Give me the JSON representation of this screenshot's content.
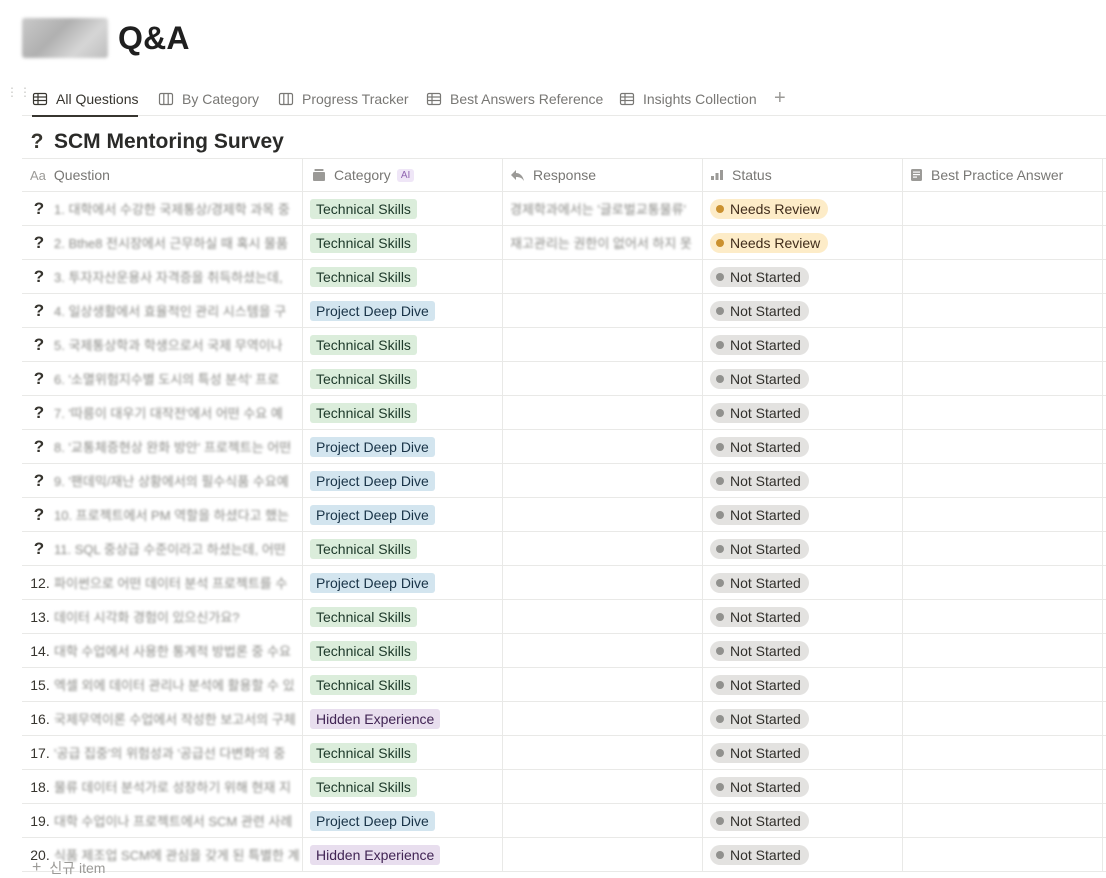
{
  "page": {
    "title": "Q&A"
  },
  "tabs": [
    {
      "label": "All Questions",
      "icon": "table-icon",
      "active": true
    },
    {
      "label": "By Category",
      "icon": "board-icon",
      "active": false
    },
    {
      "label": "Progress Tracker",
      "icon": "board-icon",
      "active": false
    },
    {
      "label": "Best Answers Reference",
      "icon": "table-icon",
      "active": false
    },
    {
      "label": "Insights Collection",
      "icon": "table-icon",
      "active": false
    }
  ],
  "database": {
    "title": "SCM Mentoring Survey"
  },
  "columns": {
    "question": "Question",
    "category": "Category",
    "category_badge": "AI",
    "response": "Response",
    "status": "Status",
    "best_answer": "Best Practice Answer"
  },
  "rows": [
    {
      "num": "",
      "text": "1. 대학에서 수강한 국제통상/경제학 과목 중",
      "category": "Technical Skills",
      "response": "경제학과에서는 '글로벌교통물류'",
      "status": "Needs Review"
    },
    {
      "num": "",
      "text": "2. Bthe8 전시장에서 근무하실 때 혹시 물품",
      "category": "Technical Skills",
      "response": "재고관리는 권한이 없어서 하지 못",
      "status": "Needs Review"
    },
    {
      "num": "",
      "text": "3. 투자자산운용사 자격증을 취득하셨는데,",
      "category": "Technical Skills",
      "response": "",
      "status": "Not Started"
    },
    {
      "num": "",
      "text": "4. 일상생활에서 효율적인 관리 시스템을 구",
      "category": "Project Deep Dive",
      "response": "",
      "status": "Not Started"
    },
    {
      "num": "",
      "text": "5. 국제통상학과 학생으로서 국제 무역이나",
      "category": "Technical Skills",
      "response": "",
      "status": "Not Started"
    },
    {
      "num": "",
      "text": "6. '소멸위험지수별 도시의 특성 분석' 프로",
      "category": "Technical Skills",
      "response": "",
      "status": "Not Started"
    },
    {
      "num": "",
      "text": "7. '따릉이 대우기 대작전'에서 어떤 수요 예",
      "category": "Technical Skills",
      "response": "",
      "status": "Not Started"
    },
    {
      "num": "",
      "text": "8. '교통체증현상 완화 방안' 프로젝트는 어떤",
      "category": "Project Deep Dive",
      "response": "",
      "status": "Not Started"
    },
    {
      "num": "",
      "text": "9. '팬데믹/재난 상황에서의 필수식품 수요예",
      "category": "Project Deep Dive",
      "response": "",
      "status": "Not Started"
    },
    {
      "num": "",
      "text": "10. 프로젝트에서 PM 역할을 하셨다고 했는",
      "category": "Project Deep Dive",
      "response": "",
      "status": "Not Started"
    },
    {
      "num": "",
      "text": "11. SQL 중상급 수준이라고 하셨는데, 어떤",
      "category": "Technical Skills",
      "response": "",
      "status": "Not Started"
    },
    {
      "num": "12.",
      "text": "파이썬으로 어떤 데이터 분석 프로젝트를 수",
      "category": "Project Deep Dive",
      "response": "",
      "status": "Not Started"
    },
    {
      "num": "13.",
      "text": "데이터 시각화 경험이 있으신가요?",
      "category": "Technical Skills",
      "response": "",
      "status": "Not Started"
    },
    {
      "num": "14.",
      "text": "대학 수업에서 사용한 통계적 방법론 중 수요",
      "category": "Technical Skills",
      "response": "",
      "status": "Not Started"
    },
    {
      "num": "15.",
      "text": "엑셀 외에 데이터 관리나 분석에 활용할 수 있",
      "category": "Technical Skills",
      "response": "",
      "status": "Not Started"
    },
    {
      "num": "16.",
      "text": "국제무역이론 수업에서 작성한 보고서의 구체",
      "category": "Hidden Experience",
      "response": "",
      "status": "Not Started"
    },
    {
      "num": "17.",
      "text": "'공급 집중'의 위험성과 '공급선 다변화'의 중",
      "category": "Technical Skills",
      "response": "",
      "status": "Not Started"
    },
    {
      "num": "18.",
      "text": "물류 데이터 분석가로 성장하기 위해 현재 지",
      "category": "Technical Skills",
      "response": "",
      "status": "Not Started"
    },
    {
      "num": "19.",
      "text": "대학 수업이나 프로젝트에서 SCM 관련 사례",
      "category": "Project Deep Dive",
      "response": "",
      "status": "Not Started"
    },
    {
      "num": "20.",
      "text": "식품 제조업 SCM에 관심을 갖게 된 특별한 계",
      "category": "Hidden Experience",
      "response": "",
      "status": "Not Started"
    }
  ],
  "footer": {
    "new_item": "신규 item"
  }
}
